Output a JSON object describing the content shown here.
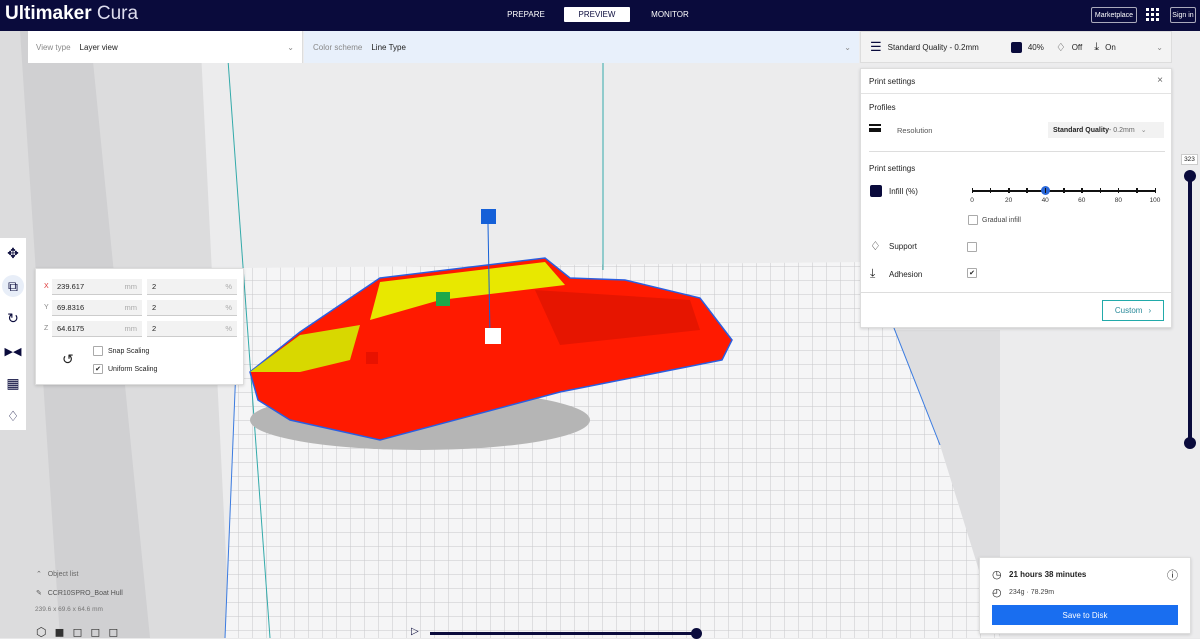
{
  "header": {
    "brand_bold": "Ultimaker",
    "brand_light": "Cura",
    "tabs": [
      {
        "label": "PREPARE",
        "active": false
      },
      {
        "label": "PREVIEW",
        "active": true
      },
      {
        "label": "MONITOR",
        "active": false
      }
    ],
    "marketplace": "Marketplace",
    "signin": "Sign in"
  },
  "viewbar": {
    "view_type_label": "View type",
    "view_type_value": "Layer view",
    "color_scheme_label": "Color scheme",
    "color_scheme_value": "Line Type"
  },
  "quickbar": {
    "profile": "Standard Quality - 0.2mm",
    "infill": "40%",
    "support": "Off",
    "adhesion": "On"
  },
  "print_settings": {
    "title": "Print settings",
    "profiles_heading": "Profiles",
    "resolution_label": "Resolution",
    "resolution_value_bold": "Standard Quality",
    "resolution_value_rest": " - 0.2mm",
    "settings_heading": "Print settings",
    "infill_label": "Infill (%)",
    "infill_value": 40,
    "infill_ticks": [
      "0",
      "20",
      "40",
      "60",
      "80",
      "100"
    ],
    "gradual_infill": "Gradual infill",
    "gradual_checked": false,
    "support_label": "Support",
    "support_checked": false,
    "adhesion_label": "Adhesion",
    "adhesion_checked": true,
    "custom_button": "Custom"
  },
  "scale_panel": {
    "rows": [
      {
        "axis": "X",
        "mm": "239.617",
        "unit": "mm",
        "pct": "2",
        "pct_unit": "%"
      },
      {
        "axis": "Y",
        "mm": "69.8316",
        "unit": "mm",
        "pct": "2",
        "pct_unit": "%"
      },
      {
        "axis": "Z",
        "mm": "64.6175",
        "unit": "mm",
        "pct": "2",
        "pct_unit": "%"
      }
    ],
    "snap": "Snap Scaling",
    "snap_checked": false,
    "uniform": "Uniform Scaling",
    "uniform_checked": true
  },
  "layer_slider": {
    "value": "323"
  },
  "object_list": {
    "title": "Object list",
    "name": "CCR10SPRO_Boat Hull",
    "dims": "239.6 x 69.6 x 64.6 mm"
  },
  "job": {
    "time": "21 hours 38 minutes",
    "material": "234g · 78.29m",
    "save": "Save to Disk"
  },
  "colors": {
    "header": "#0a0b3c",
    "accent": "#196ef0",
    "model": "#ff1a00",
    "infill": "#e8e800"
  }
}
